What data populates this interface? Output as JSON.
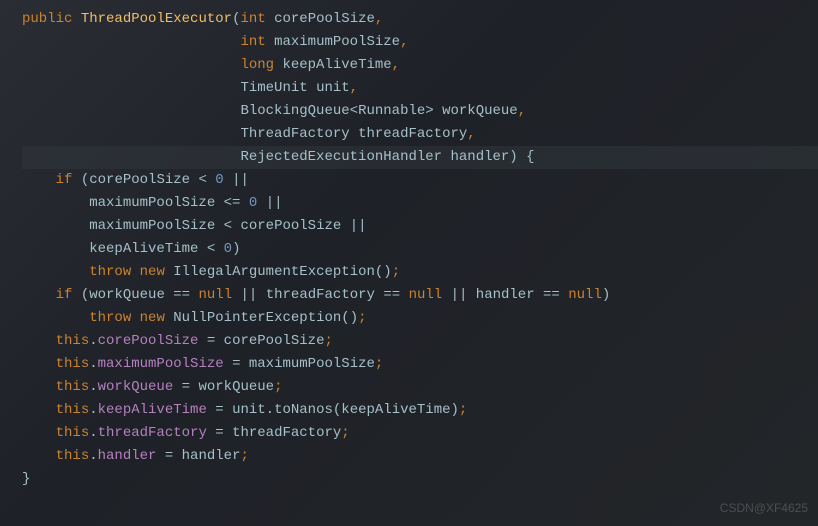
{
  "code": {
    "l1_public": "public",
    "l1_name": "ThreadPoolExecutor",
    "l1_int": "int",
    "l1_p1": "corePoolSize",
    "l2_int": "int",
    "l2_p": "maximumPoolSize",
    "l3_long": "long",
    "l3_p": "keepAliveTime",
    "l4_type": "TimeUnit",
    "l4_p": "unit",
    "l5_type": "BlockingQueue",
    "l5_gen": "Runnable",
    "l5_p": "workQueue",
    "l6_type": "ThreadFactory",
    "l6_p": "threadFactory",
    "l7_type": "RejectedExecutionHandler",
    "l7_p": "handler",
    "l8_if": "if",
    "l8_v": "corePoolSize",
    "l8_zero": "0",
    "l9_v": "maximumPoolSize",
    "l9_zero": "0",
    "l10_v1": "maximumPoolSize",
    "l10_v2": "corePoolSize",
    "l11_v": "keepAliveTime",
    "l11_zero": "0",
    "l12_throw": "throw",
    "l12_new": "new",
    "l12_ex": "IllegalArgumentException",
    "l13_if": "if",
    "l13_v1": "workQueue",
    "l13_null1": "null",
    "l13_v2": "threadFactory",
    "l13_null2": "null",
    "l13_v3": "handler",
    "l13_null3": "null",
    "l14_throw": "throw",
    "l14_new": "new",
    "l14_ex": "NullPointerException",
    "l15_this": "this",
    "l15_f": "corePoolSize",
    "l15_v": "corePoolSize",
    "l16_this": "this",
    "l16_f": "maximumPoolSize",
    "l16_v": "maximumPoolSize",
    "l17_this": "this",
    "l17_f": "workQueue",
    "l17_v": "workQueue",
    "l18_this": "this",
    "l18_f": "keepAliveTime",
    "l18_v1": "unit",
    "l18_m": "toNanos",
    "l18_v2": "keepAliveTime",
    "l19_this": "this",
    "l19_f": "threadFactory",
    "l19_v": "threadFactory",
    "l20_this": "this",
    "l20_f": "handler",
    "l20_v": "handler"
  },
  "watermark": "CSDN@XF4625"
}
